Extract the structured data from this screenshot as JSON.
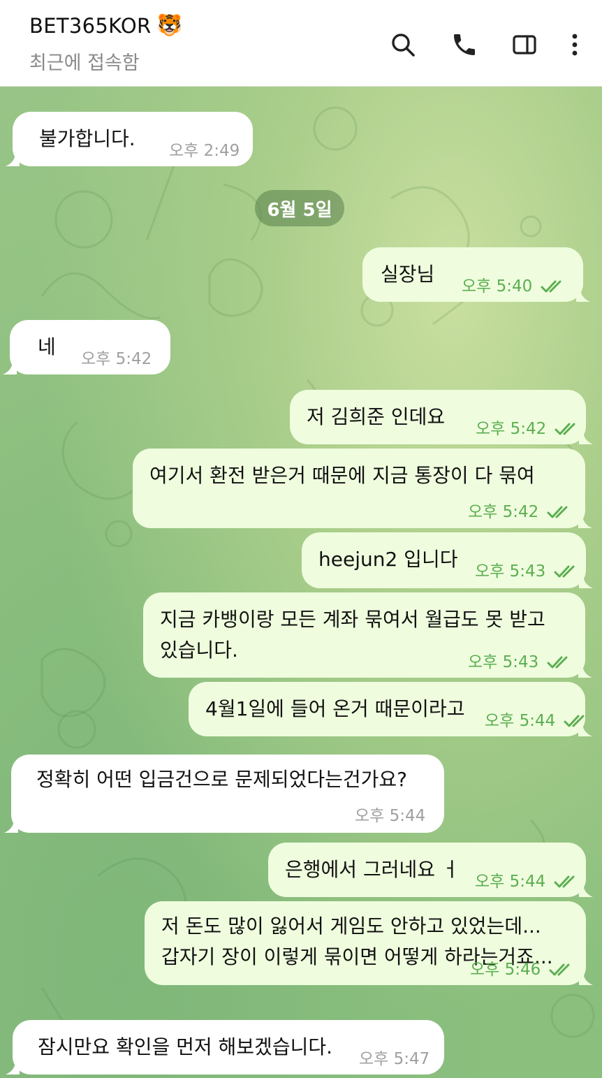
{
  "header": {
    "title": "BET365KOR",
    "title_emoji": "🐯",
    "status": "최근에 접속함",
    "icons": [
      "search-icon",
      "phone-icon",
      "sidebar-icon",
      "more-vert-icon"
    ]
  },
  "colors": {
    "incoming_bubble": "#ffffff",
    "outgoing_bubble": "#effdde",
    "outgoing_time": "#5cae52",
    "incoming_time": "#a0a0a0",
    "date_chip": "#6a9a5c"
  },
  "date_separator": "6월 5일",
  "messages": [
    {
      "dir": "in",
      "text": "불가합니다.",
      "time": "오후 2:49"
    },
    {
      "dir": "out",
      "text": "실장님",
      "time": "오후 5:40",
      "read": true
    },
    {
      "dir": "in",
      "text": "네",
      "time": "오후 5:42"
    },
    {
      "dir": "out",
      "text": "저 김희준 인데요",
      "time": "오후 5:42",
      "read": true
    },
    {
      "dir": "out",
      "text": "여기서 환전 받은거 때문에 지금 통장이 다 묶여",
      "time": "오후 5:42",
      "read": true
    },
    {
      "dir": "out",
      "text": "heejun2 입니다",
      "time": "오후 5:43",
      "read": true
    },
    {
      "dir": "out",
      "text": "지금 카뱅이랑 모든 계좌 묶여서 월급도 못 받고\n있습니다.",
      "time": "오후 5:43",
      "read": true
    },
    {
      "dir": "out",
      "text": "4월1일에 들어 온거 때문이라고",
      "time": "오후 5:44",
      "read": true
    },
    {
      "dir": "in",
      "text": "정확히 어떤 입금건으로 문제되었다는건가요?",
      "time": "오후 5:44"
    },
    {
      "dir": "out",
      "text": "은행에서 그러네요 ㅓ",
      "time": "오후 5:44",
      "read": true
    },
    {
      "dir": "out",
      "text": "저 돈도 많이 잃어서 게임도 안하고 있었는데...\n갑자기 장이 이렇게 묶이면 어떻게 하라는거죠...",
      "time": "오후 5:46",
      "read": true
    },
    {
      "dir": "in",
      "text": "잠시만요 확인을 먼저 해보겠습니다.",
      "time": "오후 5:47"
    }
  ]
}
